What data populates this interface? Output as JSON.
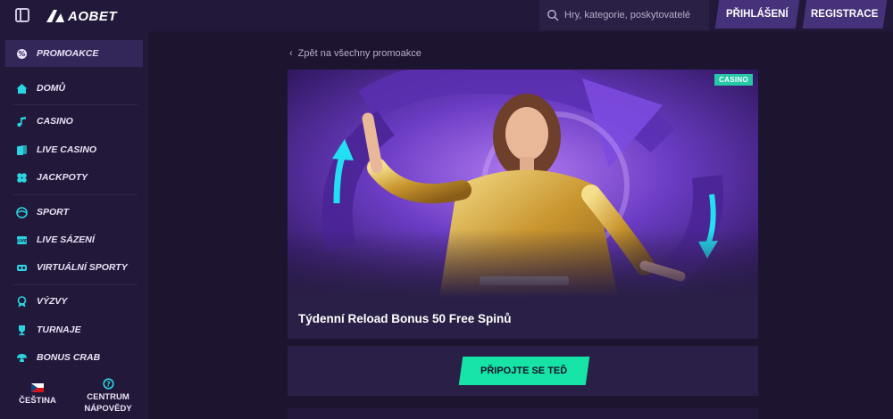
{
  "header": {
    "logo_text": "AOBET",
    "search_placeholder": "Hry, kategorie, poskytovatelé",
    "login_label": "PŘIHLÁŠENÍ",
    "register_label": "REGISTRACE"
  },
  "sidebar": {
    "items": [
      {
        "label": "PROMOAKCE",
        "icon": "promo-icon",
        "active": true
      },
      {
        "label": "DOMŮ",
        "icon": "home-icon"
      },
      {
        "label": "CASINO",
        "icon": "music-note-icon"
      },
      {
        "label": "LIVE CASINO",
        "icon": "cards-icon"
      },
      {
        "label": "JACKPOTY",
        "icon": "clover-icon"
      },
      {
        "label": "SPORT",
        "icon": "sport-icon"
      },
      {
        "label": "LIVE SÁZENÍ",
        "icon": "live-icon"
      },
      {
        "label": "VIRTUÁLNÍ SPORTY",
        "icon": "vr-icon"
      },
      {
        "label": "VÝZVY",
        "icon": "badge-icon"
      },
      {
        "label": "TURNAJE",
        "icon": "trophy-icon"
      },
      {
        "label": "BONUS CRAB",
        "icon": "crab-icon"
      }
    ],
    "language_label": "ČEŠTINA",
    "help_label_line1": "CENTRUM",
    "help_label_line2": "NÁPOVĚDY"
  },
  "main": {
    "back_link": "Zpět na všechny promoakce",
    "badge": "CASINO",
    "promo_title": "Týdenní Reload Bonus 50 Free Spinů",
    "cta_label": "PŘIPOJTE SE TEĎ"
  },
  "colors": {
    "background": "#1d1530",
    "panel": "#2a1f46",
    "accent_cta": "#16e3a6",
    "badge": "#27c7a8",
    "header_button": "#46327a"
  }
}
